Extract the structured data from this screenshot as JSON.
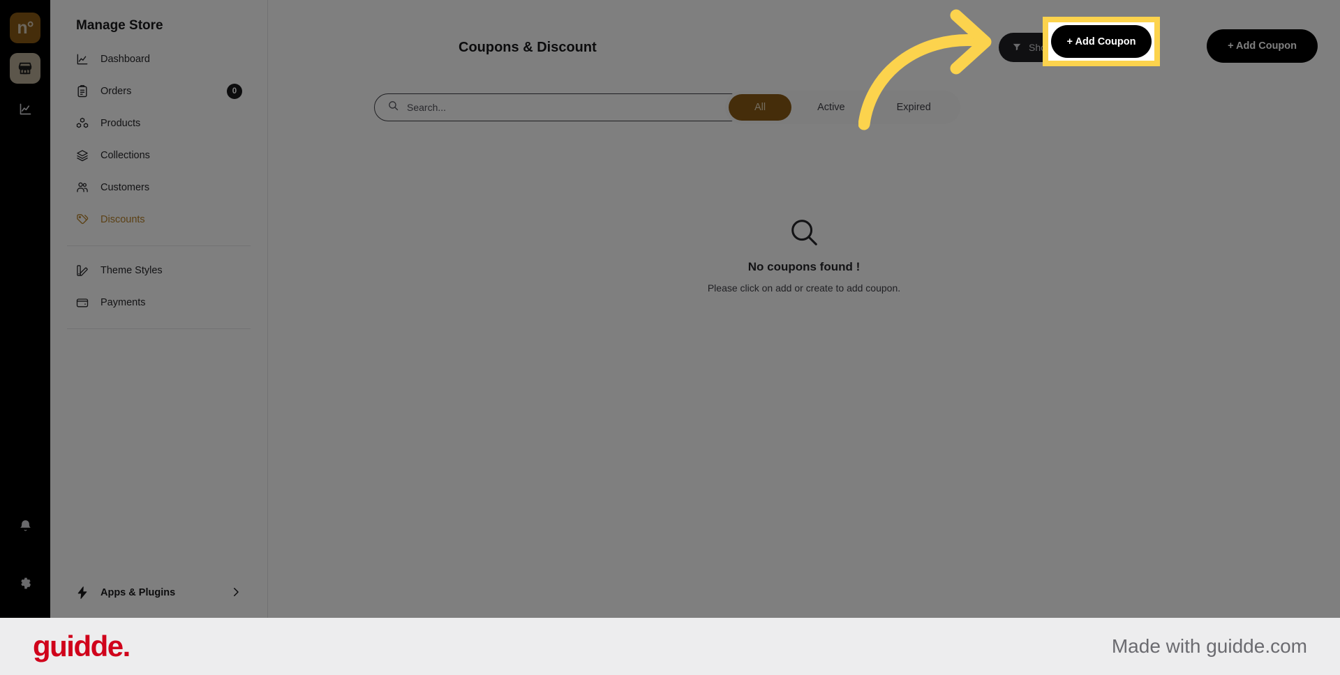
{
  "rail": {
    "logo_glyph": "n°",
    "items": [
      {
        "name": "logo",
        "label": "n°"
      },
      {
        "name": "store",
        "label": "Store"
      },
      {
        "name": "analytics",
        "label": "Analytics"
      },
      {
        "name": "notifications",
        "label": "Notifications"
      },
      {
        "name": "settings",
        "label": "Settings"
      }
    ]
  },
  "sidebar": {
    "title": "Manage Store",
    "items": [
      {
        "label": "Dashboard",
        "icon": "chart-line-icon",
        "badge": null,
        "active": false
      },
      {
        "label": "Orders",
        "icon": "clipboard-icon",
        "badge": "0",
        "active": false
      },
      {
        "label": "Products",
        "icon": "boxes-icon",
        "badge": null,
        "active": false
      },
      {
        "label": "Collections",
        "icon": "layers-icon",
        "badge": null,
        "active": false
      },
      {
        "label": "Customers",
        "icon": "users-icon",
        "badge": null,
        "active": false
      },
      {
        "label": "Discounts",
        "icon": "tag-icon",
        "badge": null,
        "active": true
      }
    ],
    "secondary_items": [
      {
        "label": "Theme Styles",
        "icon": "palette-icon"
      },
      {
        "label": "Payments",
        "icon": "wallet-icon"
      }
    ],
    "apps_plugins": {
      "label": "Apps & Plugins",
      "icon": "bolt-icon",
      "chevron": "chevron-right-icon"
    }
  },
  "main": {
    "page_title": "Coupons & Discount",
    "filter_button": {
      "label": "Show all discounts",
      "icon": "filter-icon",
      "chevron": "chevron-down-icon"
    },
    "add_coupon_button": {
      "label": "Add Coupon",
      "prefix": "+"
    },
    "search": {
      "placeholder": "Search...",
      "value": "",
      "icon": "search-icon"
    },
    "tabs": [
      {
        "label": "All",
        "active": true
      },
      {
        "label": "Active",
        "active": false
      },
      {
        "label": "Expired",
        "active": false
      }
    ],
    "empty_state": {
      "icon": "magnifier-icon",
      "title": "No coupons found !",
      "subtitle": "Please click on add or create to add coupon."
    }
  },
  "highlight": {
    "button_label": "+ Add Coupon",
    "border_color": "#fcd34d",
    "arrow_color": "#fcd34d"
  },
  "footer": {
    "brand": "guidde.",
    "made_with": "Made with guidde.com",
    "brand_color": "#d0021b"
  }
}
